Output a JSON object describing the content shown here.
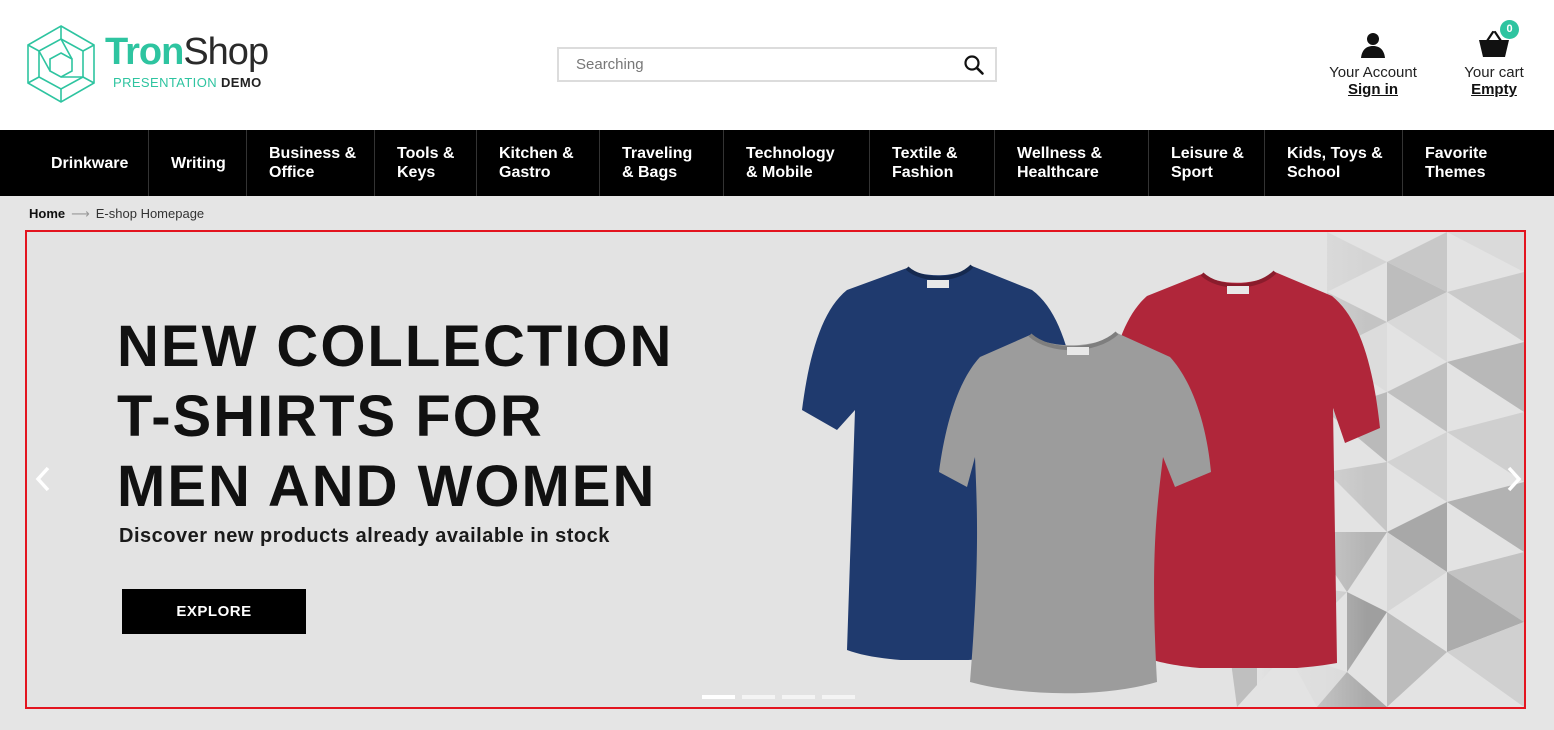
{
  "header": {
    "logo": {
      "word_1": "Tron",
      "word_2": "Shop",
      "sub_1": "PRESENTATION",
      "sub_2": "DEMO",
      "brand_color": "#2ec4a0"
    },
    "search": {
      "placeholder": "Searching",
      "value": "",
      "icon": "search-icon"
    },
    "account": {
      "label": "Your Account",
      "link": "Sign in",
      "icon": "user-icon"
    },
    "cart": {
      "label": "Your cart",
      "status": "Empty",
      "count": "0",
      "icon": "basket-icon"
    }
  },
  "nav": {
    "items": [
      {
        "label": "Drinkware"
      },
      {
        "label": "Writing"
      },
      {
        "label": "Business &\nOffice"
      },
      {
        "label": "Tools &\nKeys"
      },
      {
        "label": "Kitchen &\nGastro"
      },
      {
        "label": "Traveling\n& Bags"
      },
      {
        "label": "Technology\n& Mobile"
      },
      {
        "label": "Textile &\nFashion"
      },
      {
        "label": "Wellness &\nHealthcare"
      },
      {
        "label": "Leisure &\nSport"
      },
      {
        "label": "Kids, Toys &\nSchool"
      },
      {
        "label": "Favorite\nThemes"
      }
    ]
  },
  "breadcrumb": {
    "home": "Home",
    "current": "E-shop Homepage"
  },
  "slider": {
    "headline_1": "NEW COLLECTION",
    "headline_2": "T-SHIRTS FOR",
    "headline_3": "MEN AND WOMEN",
    "subline": "Discover new products already available in stock",
    "cta": "EXPLORE",
    "frame_color": "#e3141f",
    "shirt_colors": [
      "#1f3a6e",
      "#9c9c9c",
      "#b0263a"
    ],
    "slide_count": 4,
    "active_slide": 1
  }
}
